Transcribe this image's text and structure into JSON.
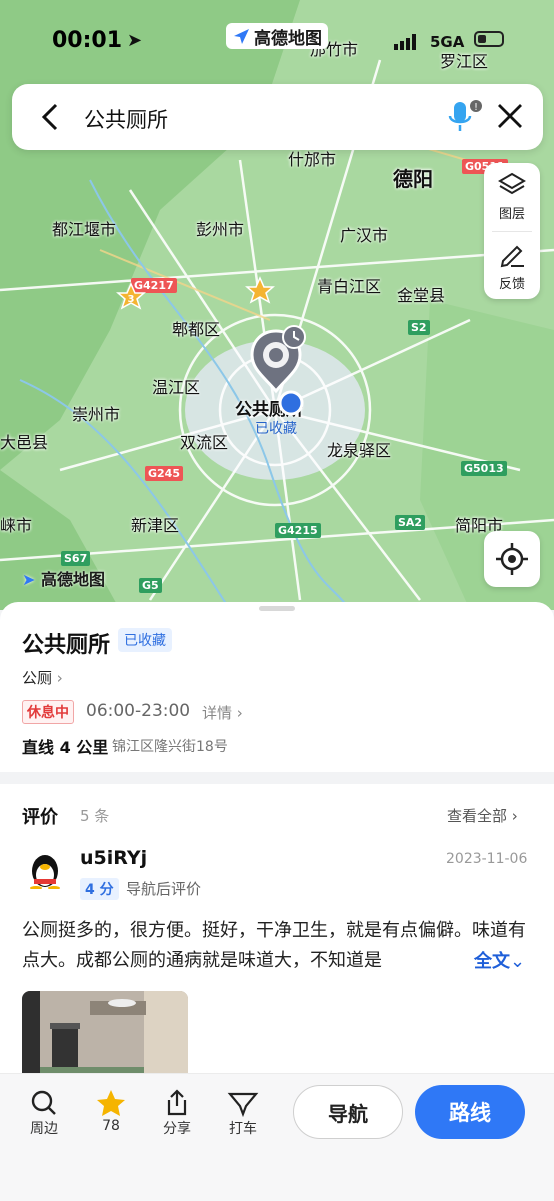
{
  "status_bar": {
    "time": "00:01",
    "app_badge": "高德地图",
    "network": "5GA"
  },
  "search": {
    "query": "公共厕所"
  },
  "map": {
    "controls": {
      "layers_label": "图层",
      "feedback_label": "反馈"
    },
    "labels": [
      "邡竹市",
      "罗江区",
      "什邡市",
      "德阳",
      "都江堰市",
      "彭州市",
      "广汉市",
      "青白江区",
      "金堂县",
      "郫都区",
      "温江区",
      "崇州市",
      "大邑县",
      "双流区",
      "龙泉驿区",
      "新津区",
      "简阳市",
      "崃市"
    ],
    "road_badges": [
      "G0511",
      "G5",
      "G4215",
      "G245",
      "G5013",
      "S2",
      "SA2",
      "S67",
      "G5",
      "G4217"
    ],
    "poi": {
      "name": "公共厕所",
      "sub": "已收藏"
    },
    "watermark": "高德地图"
  },
  "place": {
    "name": "公共厕所",
    "saved_tag": "已收藏",
    "category": "公厕",
    "status": "休息中",
    "hours": "06:00-23:00",
    "details_link": "详情",
    "distance": "直线 4 公里",
    "address": "锦江区隆兴街18号"
  },
  "reviews": {
    "title": "评价",
    "count": "5 条",
    "view_all": "查看全部",
    "items": [
      {
        "user": "u5iRYj",
        "date": "2023-11-06",
        "score": "4 分",
        "type": "导航后评价",
        "text": "公厕挺多的，很方便。挺好，干净卫生，就是有点偏僻。味道有点大。成都公厕的通病就是味道大，不知道是",
        "more": "全文"
      }
    ]
  },
  "bottom_bar": {
    "tabs": [
      {
        "label": "周边",
        "icon": "search-icon"
      },
      {
        "label": "78",
        "icon": "star-icon"
      },
      {
        "label": "分享",
        "icon": "share-icon"
      },
      {
        "label": "打车",
        "icon": "taxi-icon"
      }
    ],
    "nav_button": "导航",
    "route_button": "路线"
  },
  "colors": {
    "accent": "#2f78f6",
    "map_green": "#a9d8a0",
    "closed_red": "#e23b3b"
  }
}
